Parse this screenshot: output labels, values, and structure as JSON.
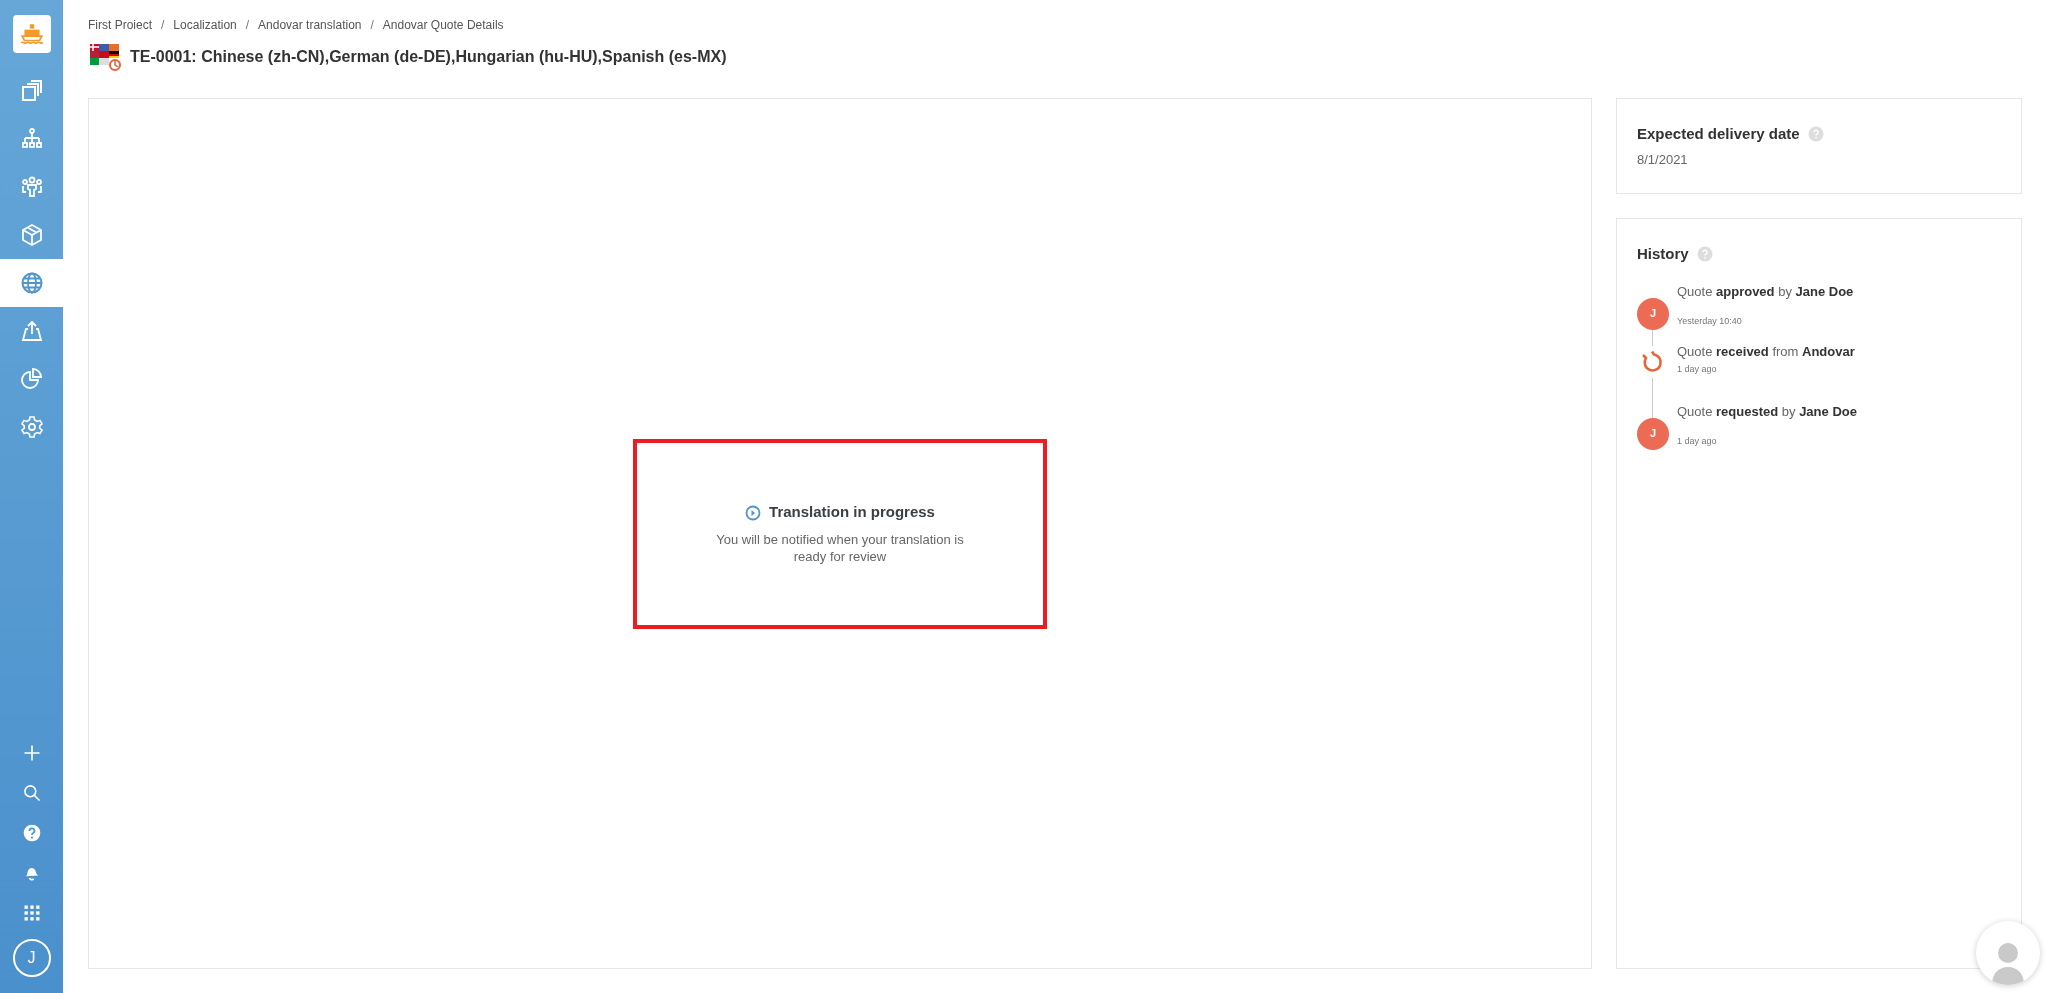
{
  "sidebar": {
    "nav_items": [
      {
        "selected": false
      },
      {
        "selected": false
      },
      {
        "selected": false
      },
      {
        "selected": false
      },
      {
        "selected": true
      },
      {
        "selected": false
      },
      {
        "selected": false
      },
      {
        "selected": false
      }
    ],
    "user_initial": "J"
  },
  "breadcrumb": [
    {
      "kind": "link",
      "text": "First Proiect"
    },
    {
      "kind": "separator",
      "text": "/"
    },
    {
      "kind": "link",
      "text": "Localization"
    },
    {
      "kind": "separator",
      "text": "/"
    },
    {
      "kind": "link",
      "text": "Andovar translation"
    },
    {
      "kind": "separator",
      "text": "/"
    },
    {
      "kind": "link",
      "text": "Andovar Quote Details"
    }
  ],
  "page_title": "TE-0001: Chinese (zh-CN),German (de-DE),Hungarian (hu-HU),Spanish (es-MX)",
  "status_panel": {
    "title": "Translation in progress",
    "message": "You will be notified when your translation is ready for review"
  },
  "delivery": {
    "label": "Expected delivery date",
    "value": "8/1/2021"
  },
  "history": {
    "title": "History",
    "events": [
      {
        "kind": "user",
        "initial": "J",
        "text": "Quote **approved** by **Jane Doe**",
        "time": "Yesterday 10:40"
      },
      {
        "kind": "vendor",
        "text": "Quote **received** from **Andovar**",
        "time": "1 day ago"
      },
      {
        "kind": "user",
        "initial": "J",
        "text": "Quote **requested** by **Jane Doe**",
        "time": "1 day ago"
      }
    ]
  }
}
